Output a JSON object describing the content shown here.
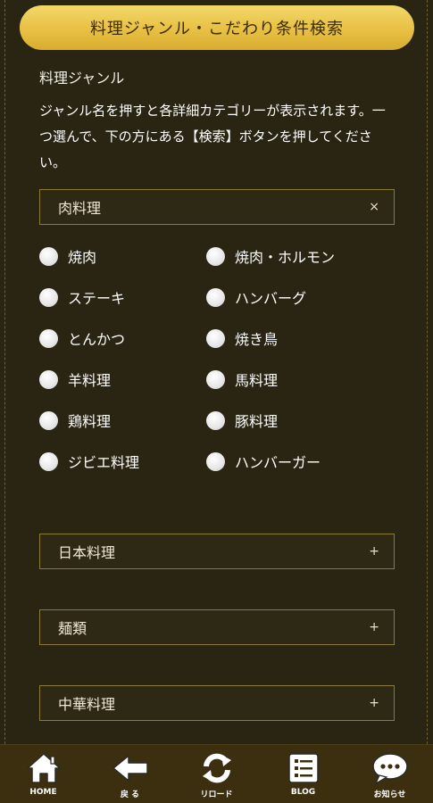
{
  "banner": {
    "title": "料理ジャンル・こだわり条件検索"
  },
  "section": {
    "label": "料理ジャンル",
    "description": "ジャンル名を押すと各詳細カテゴリーが表示されます。一つ選んで、下の方にある【検索】ボタンを押してください。"
  },
  "categories": [
    {
      "label": "肉料理",
      "symbol": "×"
    },
    {
      "label": "日本料理",
      "symbol": "+"
    },
    {
      "label": "麺類",
      "symbol": "+"
    },
    {
      "label": "中華料理",
      "symbol": "+"
    }
  ],
  "meat_options": [
    "焼肉",
    "焼肉・ホルモン",
    "ステーキ",
    "ハンバーグ",
    "とんかつ",
    "焼き鳥",
    "羊料理",
    "馬料理",
    "鶏料理",
    "豚料理",
    "ジビエ料理",
    "ハンバーガー"
  ],
  "bottom_nav": [
    {
      "label": "HOME",
      "icon": "home-icon"
    },
    {
      "label": "戻 る",
      "icon": "back-arrow-icon"
    },
    {
      "label": "リロード",
      "icon": "reload-icon"
    },
    {
      "label": "BLOG",
      "icon": "blog-icon"
    },
    {
      "label": "お知らせ",
      "icon": "chat-bubble-icon"
    }
  ],
  "colors": {
    "background": "#2a2513",
    "accent_gold": "#e9c246",
    "border": "#8a7a33",
    "nav_bar": "#3b2f10"
  }
}
